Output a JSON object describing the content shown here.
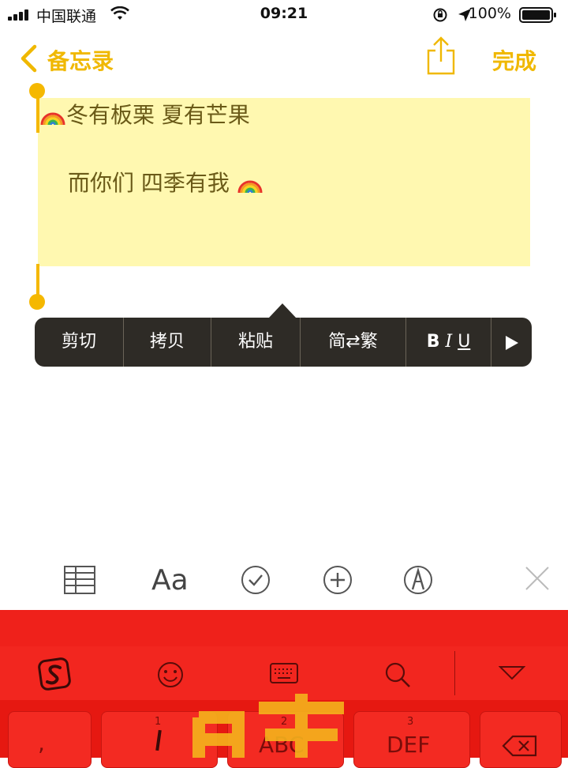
{
  "status_bar": {
    "carrier": "中国联通",
    "time": "09:21",
    "battery": "100%"
  },
  "nav": {
    "back_label": "备忘录",
    "done_label": "完成"
  },
  "note": {
    "line1": "冬有板栗 夏有芒果",
    "line2": "而你们 四季有我"
  },
  "edit_menu": {
    "items": [
      "剪切",
      "拷贝",
      "粘贴",
      "简⇄繁"
    ],
    "format_bold": "B",
    "format_italic": "I",
    "format_underline": "U"
  },
  "toolbar": {
    "format_label": "Aa"
  },
  "keyboard": {
    "keys": [
      {
        "label": ",",
        "number": ""
      },
      {
        "label": "",
        "number": "1"
      },
      {
        "label": "ABC",
        "number": "2"
      },
      {
        "label": "DEF",
        "number": "3"
      }
    ]
  },
  "colors": {
    "accent": "#f0b800",
    "menu_bg": "#2e2b26",
    "keyboard_bg": "#ee1a14",
    "selection": "#fff8b0"
  }
}
